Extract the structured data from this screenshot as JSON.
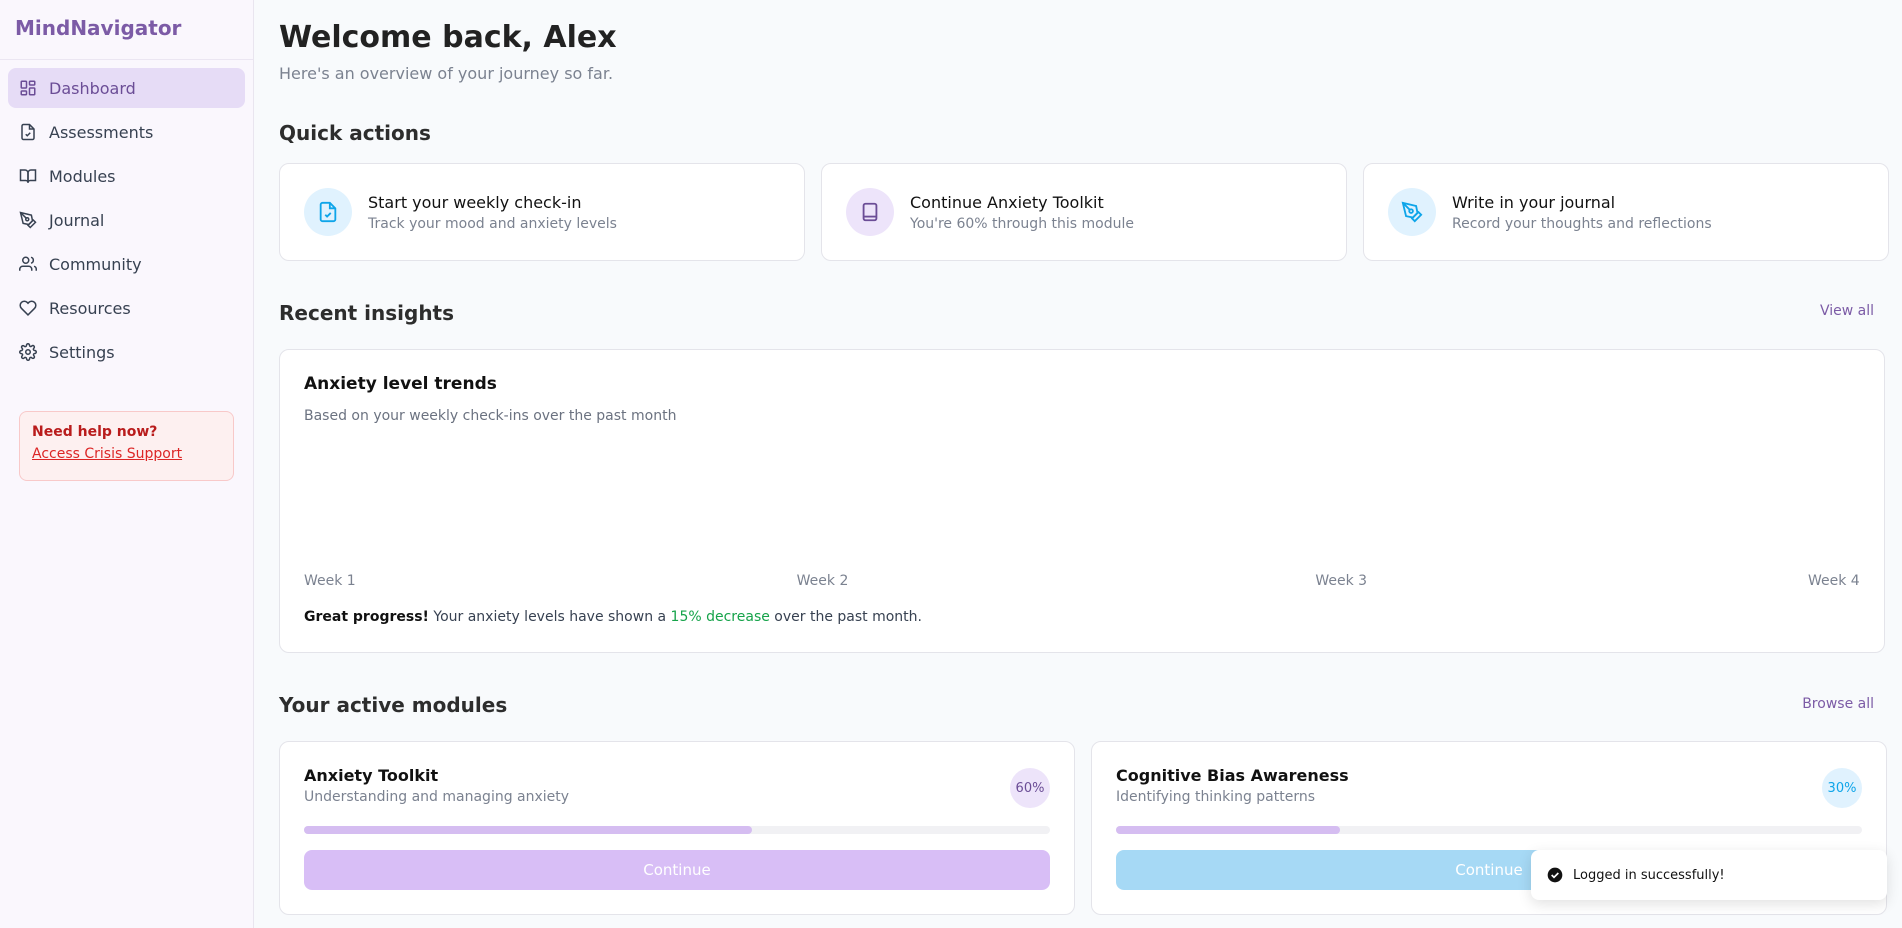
{
  "brand": "MindNavigator",
  "sidebar": {
    "items": [
      {
        "label": "Dashboard",
        "icon": "grid-icon"
      },
      {
        "label": "Assessments",
        "icon": "file-check-icon"
      },
      {
        "label": "Modules",
        "icon": "book-open-icon"
      },
      {
        "label": "Journal",
        "icon": "pen-tool-icon"
      },
      {
        "label": "Community",
        "icon": "users-icon"
      },
      {
        "label": "Resources",
        "icon": "heart-icon"
      },
      {
        "label": "Settings",
        "icon": "gear-icon"
      }
    ],
    "help": {
      "title": "Need help now?",
      "link": "Access Crisis Support"
    }
  },
  "header": {
    "title": "Welcome back, Alex",
    "subtitle": "Here's an overview of your journey so far."
  },
  "quick_actions": {
    "title": "Quick actions",
    "cards": [
      {
        "title": "Start your weekly check-in",
        "subtitle": "Track your mood and anxiety levels",
        "icon": "file-check-icon",
        "color": "#e0f2fe",
        "icon_color": "#0ea5e9"
      },
      {
        "title": "Continue Anxiety Toolkit",
        "subtitle": "You're 60% through this module",
        "icon": "book-icon",
        "color": "#ede4fa",
        "icon_color": "#6b4d96"
      },
      {
        "title": "Write in your journal",
        "subtitle": "Record your thoughts and reflections",
        "icon": "pen-tool-icon",
        "color": "#e0f2fe",
        "icon_color": "#0ea5e9"
      }
    ]
  },
  "insights": {
    "title": "Recent insights",
    "view_all": "View all",
    "chart_title": "Anxiety level trends",
    "chart_subtitle": "Based on your weekly check-ins over the past month",
    "note_bold": "Great progress!",
    "note_mid": " Your anxiety levels have shown a ",
    "note_green": "15% decrease",
    "note_end": " over the past month."
  },
  "chart_data": {
    "type": "bar",
    "categories": [
      "Week 1",
      "Week 2",
      "Week 3",
      "Week 4"
    ],
    "values": [],
    "title": "Anxiety level trends",
    "subtitle": "Based on your weekly check-ins over the past month",
    "xlabel": "",
    "ylabel": "",
    "grid": false
  },
  "modules": {
    "title": "Your active modules",
    "browse_all": "Browse all",
    "items": [
      {
        "title": "Anxiety Toolkit",
        "subtitle": "Understanding and managing anxiety",
        "progress": 60,
        "badge": "60%",
        "button": "Continue",
        "badge_bg": "#ede4fa",
        "badge_color": "#6b4d96",
        "btn_color": "#d8bef6"
      },
      {
        "title": "Cognitive Bias Awareness",
        "subtitle": "Identifying thinking patterns",
        "progress": 30,
        "badge": "30%",
        "button": "Continue",
        "badge_bg": "#e0f2fe",
        "badge_color": "#0ea5e9",
        "btn_color": "#a6d9f5"
      }
    ]
  },
  "toast": {
    "message": "Logged in successfully!"
  }
}
